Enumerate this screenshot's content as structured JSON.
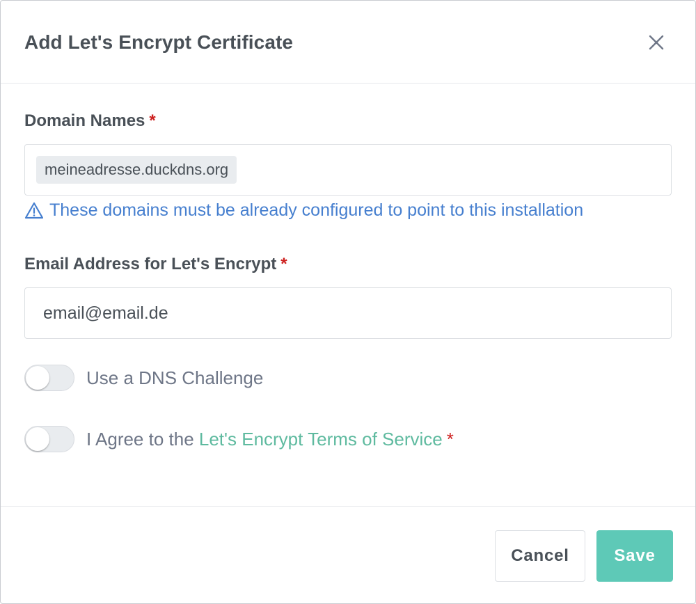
{
  "modal": {
    "title": "Add Let's Encrypt Certificate"
  },
  "domain_names": {
    "label": "Domain Names",
    "required_mark": "*",
    "tags": [
      "meineadresse.duckdns.org"
    ],
    "hint": "These domains must be already configured to point to this installation"
  },
  "email": {
    "label": "Email Address for Let's Encrypt",
    "required_mark": "*",
    "value": "email@email.de"
  },
  "dns_challenge": {
    "label": "Use a DNS Challenge",
    "enabled": false
  },
  "agree_tos": {
    "label_prefix": "I Agree to the ",
    "link_text": "Let's Encrypt Terms of Service",
    "required_mark": "*",
    "enabled": false
  },
  "footer": {
    "cancel_label": "Cancel",
    "save_label": "Save"
  },
  "colors": {
    "accent": "#5ec9b7",
    "link": "#5eba9f",
    "hint": "#467fcf",
    "required": "#cd201f"
  },
  "icons": {
    "close": "close-icon",
    "warning": "warning-triangle-icon"
  }
}
